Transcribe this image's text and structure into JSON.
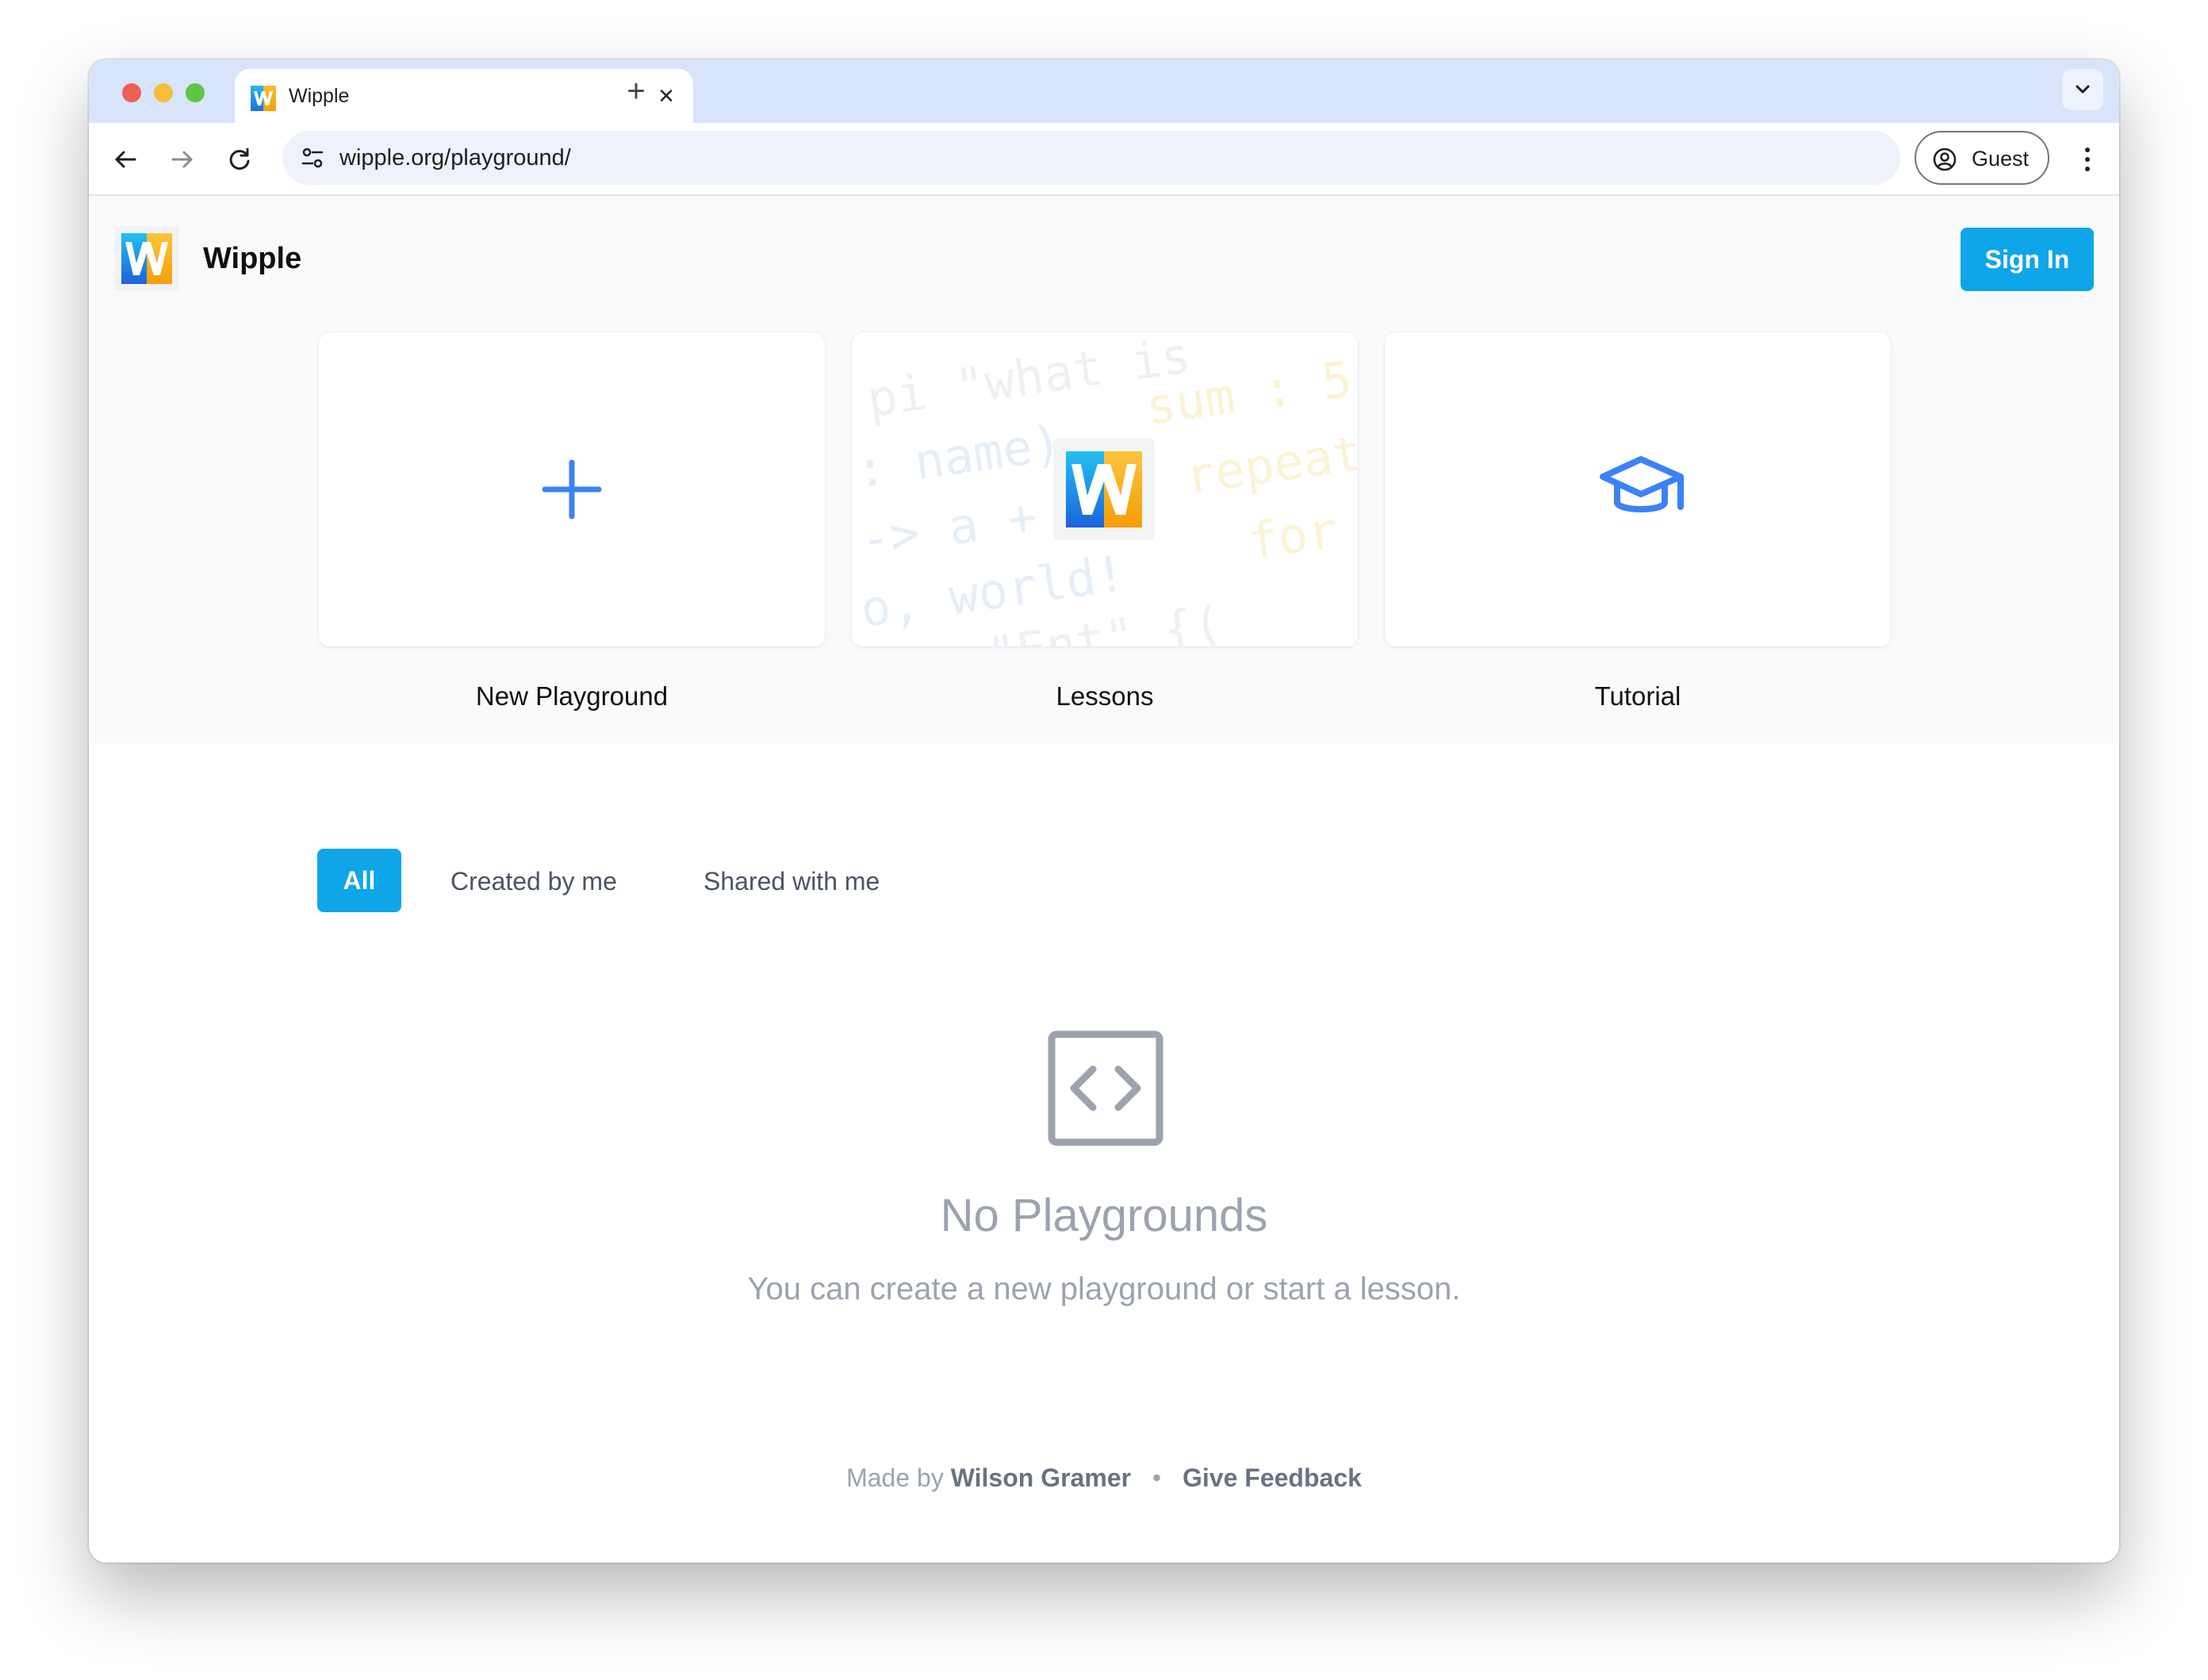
{
  "browser": {
    "tab_title": "Wipple",
    "tab_close": "×",
    "new_tab": "+",
    "url": "wipple.org/playground/",
    "profile_label": "Guest"
  },
  "app": {
    "brand_name": "Wipple",
    "sign_in_label": "Sign In"
  },
  "cards": [
    {
      "label": "New Playground",
      "icon": "plus-icon"
    },
    {
      "label": "Lessons",
      "icon": "wipple-logo"
    },
    {
      "label": "Tutorial",
      "icon": "graduation-cap-icon"
    }
  ],
  "lessons_code_background": [
    "pi \"what is",
    "sum : 5",
    ": name)",
    "repeat",
    "-> a +",
    "for",
    "o, world!",
    "\"Ent\" {("
  ],
  "filters": {
    "all": "All",
    "created": "Created by me",
    "shared": "Shared with me"
  },
  "empty_state": {
    "icon": "code-icon",
    "title": "No Playgrounds",
    "subtitle": "You can create a new playground or start a lesson."
  },
  "footer": {
    "made_by_prefix": "Made by",
    "author": "Wilson Gramer",
    "separator": "•",
    "feedback": "Give Feedback"
  },
  "colors": {
    "accent": "#0ea5e9",
    "icon_blue": "#3b82f6",
    "muted": "#9ca3af",
    "tab_strip": "#d8e4f9"
  }
}
